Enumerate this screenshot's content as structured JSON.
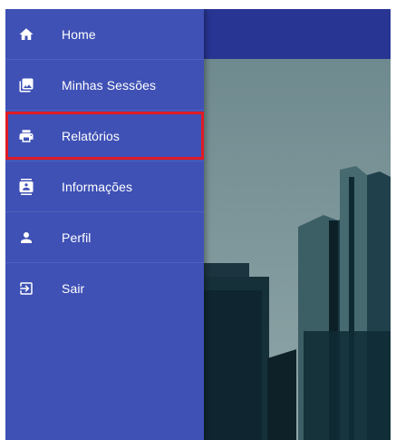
{
  "nav": {
    "items": [
      {
        "label": "Home",
        "icon": "home-icon"
      },
      {
        "label": "Minhas Sessões",
        "icon": "photo-library-icon"
      },
      {
        "label": "Relatórios",
        "icon": "printer-icon"
      },
      {
        "label": "Informações",
        "icon": "contact-card-icon"
      },
      {
        "label": "Perfil",
        "icon": "person-icon"
      },
      {
        "label": "Sair",
        "icon": "exit-icon"
      }
    ],
    "highlighted_item": "Relatórios"
  },
  "colors": {
    "drawer": "#3f51b5",
    "appbar": "#283593",
    "highlight": "#e01b24"
  }
}
